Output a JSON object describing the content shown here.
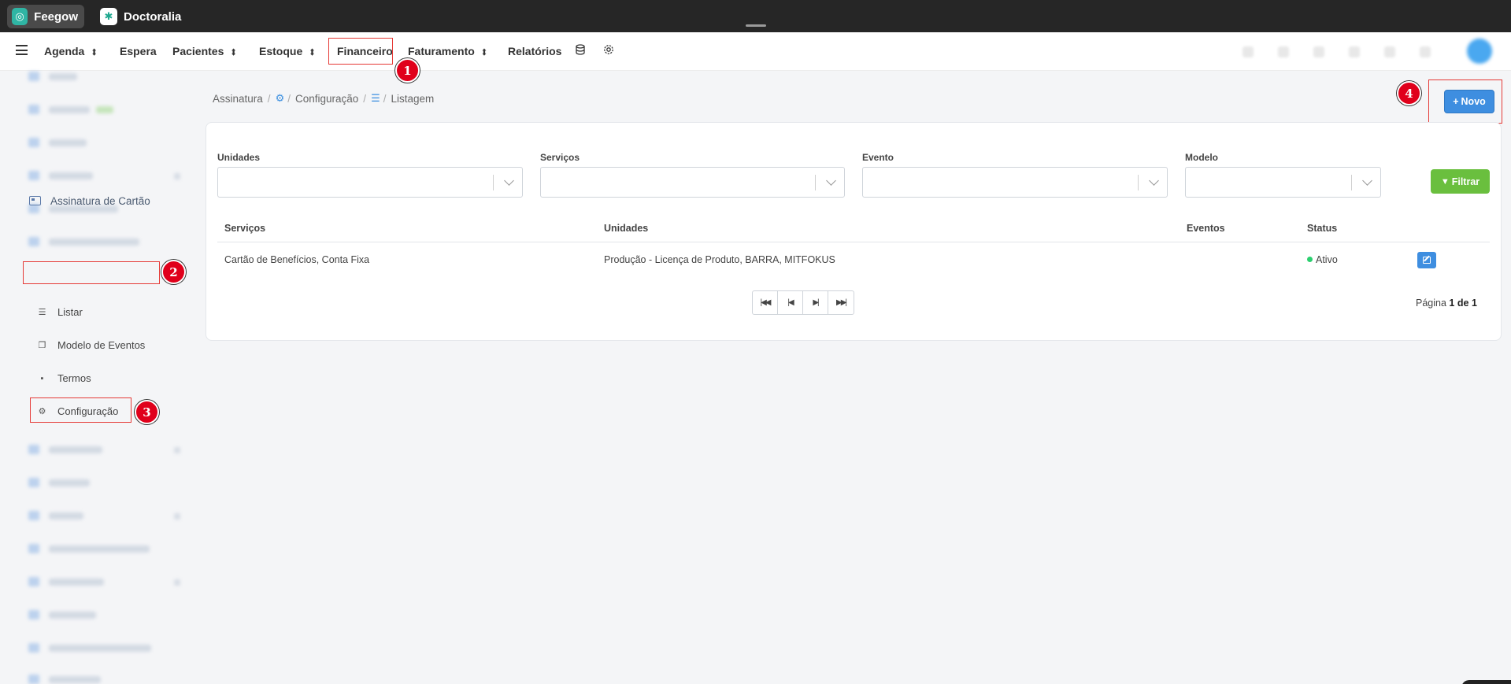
{
  "apps": {
    "feegow": "Feegow",
    "doctoralia": "Doctoralia"
  },
  "nav": {
    "agenda": "Agenda",
    "espera": "Espera",
    "pacientes": "Pacientes",
    "estoque": "Estoque",
    "financeiro": "Financeiro",
    "faturamento": "Faturamento",
    "relatorios": "Relatórios"
  },
  "steps": [
    "1",
    "2",
    "3",
    "4"
  ],
  "sidebar": {
    "active_label": "Assinatura de Cartão",
    "sub_items": [
      "Listar",
      "Modelo de Eventos",
      "Termos",
      "Configuração"
    ]
  },
  "breadcrumb": {
    "root": "Assinatura",
    "config": "Configuração",
    "list": "Listagem"
  },
  "toolbar": {
    "novo": "Novo",
    "filtrar": "Filtrar"
  },
  "filters": {
    "unidades": "Unidades",
    "servicos": "Serviços",
    "evento": "Evento",
    "modelo": "Modelo"
  },
  "table": {
    "headers": [
      "Serviços",
      "Unidades",
      "Eventos",
      "Status"
    ],
    "rows": [
      {
        "servicos": "Cartão de Benefícios, Conta Fixa",
        "unidades": "Produção - Licença de Produto, BARRA, MITFOKUS",
        "eventos": "",
        "status": "Ativo"
      }
    ]
  },
  "pagination": {
    "prefix": "Página",
    "current": "1",
    "of": "de",
    "total": "1"
  },
  "colors": {
    "primary": "#3e8ee0",
    "success": "#6abf3e",
    "status_active": "#2bd06f",
    "highlight": "#e53935",
    "step_badge": "#e0001b"
  }
}
